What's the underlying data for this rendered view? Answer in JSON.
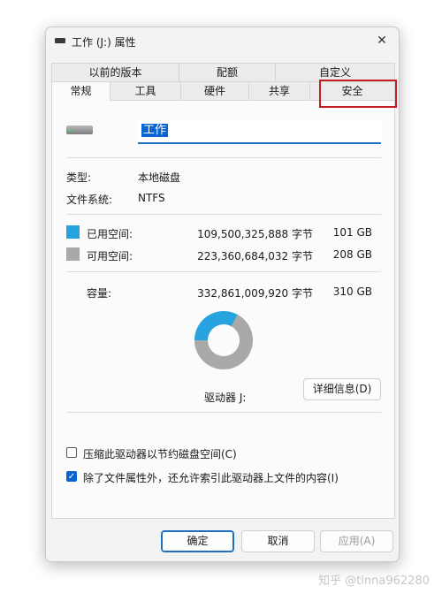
{
  "window": {
    "title": "工作 (J:) 属性",
    "close_glyph": "✕"
  },
  "tabs": {
    "top": [
      {
        "label": "以前的版本"
      },
      {
        "label": "配额"
      },
      {
        "label": "自定义"
      }
    ],
    "bottom": [
      {
        "label": "常规"
      },
      {
        "label": "工具"
      },
      {
        "label": "硬件"
      },
      {
        "label": "共享"
      },
      {
        "label": "安全"
      }
    ],
    "active": "常规",
    "highlighted": "安全"
  },
  "general": {
    "drive_name": "工作",
    "type_label": "类型:",
    "type_value": "本地磁盘",
    "fs_label": "文件系统:",
    "fs_value": "NTFS",
    "used_label": "已用空间:",
    "used_bytes": "109,500,325,888 字节",
    "used_size": "101 GB",
    "free_label": "可用空间:",
    "free_bytes": "223,360,684,032 字节",
    "free_size": "208 GB",
    "capacity_label": "容量:",
    "capacity_bytes": "332,861,009,920 字节",
    "capacity_size": "310 GB",
    "drive_letter_label": "驱动器 J:",
    "details_button": "详细信息(D)",
    "compress_label": "压缩此驱动器以节约磁盘空间(C)",
    "compress_checked": false,
    "index_label": "除了文件属性外，还允许索引此驱动器上文件的内容(I)",
    "index_checked": true
  },
  "usage": {
    "used_fraction": 0.329,
    "used_color": "#27a3e0",
    "free_color": "#a9a9a9"
  },
  "buttons": {
    "ok": "确定",
    "cancel": "取消",
    "apply": "应用(A)"
  },
  "watermark": "知乎 @tinna962280"
}
